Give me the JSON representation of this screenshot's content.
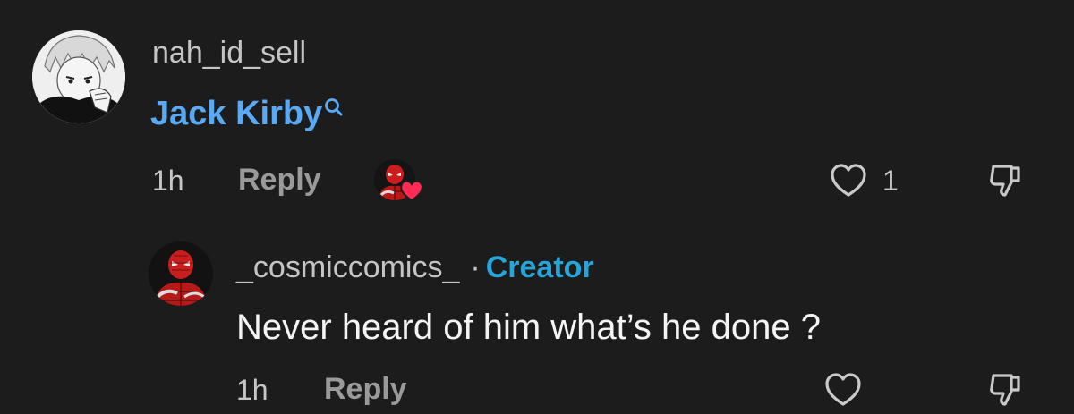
{
  "comments": [
    {
      "username": "nah_id_sell",
      "text": "Jack Kirby",
      "time": "1h",
      "reply_label": "Reply",
      "like_count": "1",
      "liked_by_creator": true
    }
  ],
  "replies": [
    {
      "username": "_cosmiccomics_",
      "separator": "·",
      "badge": "Creator",
      "text": "Never heard of him what’s he done ?",
      "time": "1h",
      "reply_label": "Reply"
    }
  ],
  "colors": {
    "background": "#1c1c1c",
    "link": "#59a9f5",
    "creator_badge": "#27a4d8",
    "heart": "#fe2c55"
  },
  "icons": [
    "search-icon",
    "heart-icon",
    "dislike-icon",
    "creator-heart-icon"
  ]
}
